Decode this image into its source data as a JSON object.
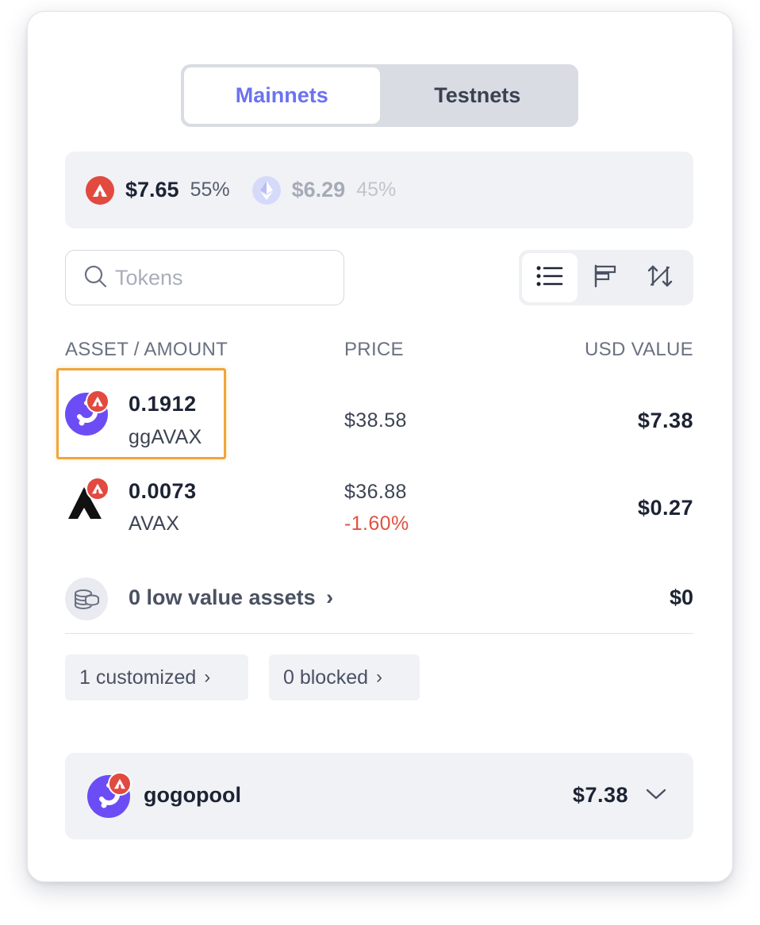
{
  "network_toggle": {
    "mainnets": "Mainnets",
    "testnets": "Testnets",
    "selected": "Mainnets"
  },
  "summary": [
    {
      "icon": "avalanche-icon",
      "value": "$7.65",
      "percent": "55%",
      "color": "#e24a3f"
    },
    {
      "icon": "ethereum-icon",
      "value": "$6.29",
      "percent": "45%",
      "color": "#c9cdf5"
    }
  ],
  "search": {
    "placeholder": "Tokens",
    "value": ""
  },
  "view_buttons": [
    "list-view-icon",
    "bar-chart-icon",
    "sort-icon"
  ],
  "table": {
    "headers": {
      "asset": "ASSET / AMOUNT",
      "price": "PRICE",
      "usd": "USD VALUE"
    },
    "rows": [
      {
        "amount": "0.1912",
        "symbol": "ggAVAX",
        "price": "$38.58",
        "change": "",
        "usd": "$7.38",
        "icon": "ggavax-icon"
      },
      {
        "amount": "0.0073",
        "symbol": "AVAX",
        "price": "$36.88",
        "change": "-1.60%",
        "usd": "$0.27",
        "icon": "avax-icon"
      }
    ]
  },
  "low_value": {
    "label": "0 low value assets",
    "chevron": "›",
    "value": "$0"
  },
  "chips": {
    "customized": "1 customized",
    "blocked": "0 blocked",
    "chevron": "›"
  },
  "protocol": {
    "name": "gogopool",
    "value": "$7.38"
  },
  "colors": {
    "accent": "#6b72f2",
    "avalanche": "#e24a3f",
    "negative": "#e0523f",
    "highlight": "#f0a53a",
    "gogopool": "#6c4df5"
  }
}
